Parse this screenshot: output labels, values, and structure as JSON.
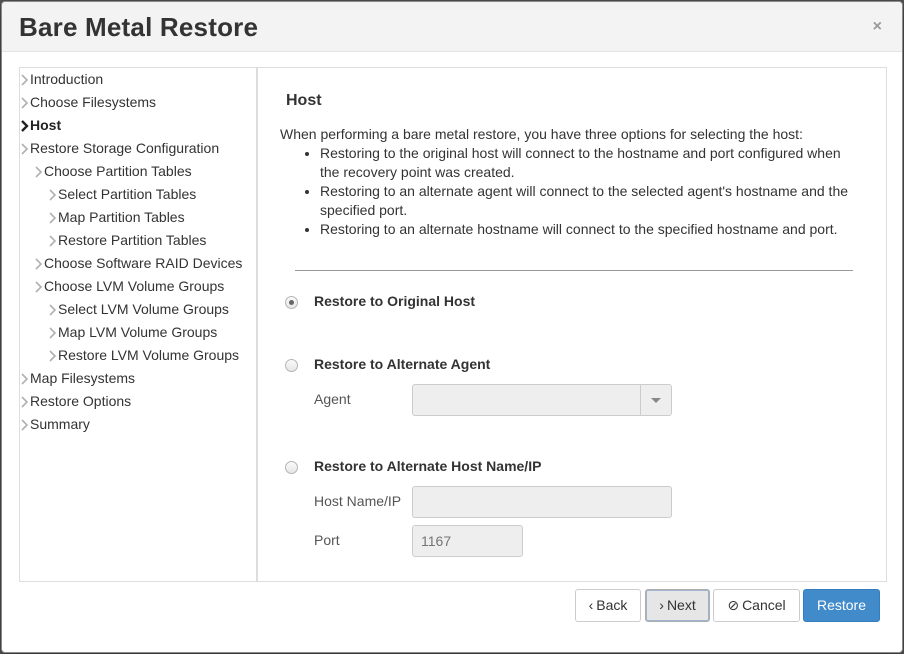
{
  "dialog": {
    "title": "Bare Metal Restore",
    "close_icon": "×"
  },
  "nav": {
    "items": [
      {
        "label": "Introduction",
        "level": 0,
        "active": false
      },
      {
        "label": "Choose Filesystems",
        "level": 0,
        "active": false
      },
      {
        "label": "Host",
        "level": 0,
        "active": true
      },
      {
        "label": "Restore Storage Configuration",
        "level": 0,
        "active": false
      },
      {
        "label": "Choose Partition Tables",
        "level": 1,
        "active": false
      },
      {
        "label": "Select Partition Tables",
        "level": 2,
        "active": false
      },
      {
        "label": "Map Partition Tables",
        "level": 2,
        "active": false
      },
      {
        "label": "Restore Partition Tables",
        "level": 2,
        "active": false
      },
      {
        "label": "Choose Software RAID Devices",
        "level": 1,
        "active": false
      },
      {
        "label": "Choose LVM Volume Groups",
        "level": 1,
        "active": false
      },
      {
        "label": "Select LVM Volume Groups",
        "level": 2,
        "active": false
      },
      {
        "label": "Map LVM Volume Groups",
        "level": 2,
        "active": false
      },
      {
        "label": "Restore LVM Volume Groups",
        "level": 2,
        "active": false
      },
      {
        "label": "Map Filesystems",
        "level": 0,
        "active": false
      },
      {
        "label": "Restore Options",
        "level": 0,
        "active": false
      },
      {
        "label": "Summary",
        "level": 0,
        "active": false
      }
    ]
  },
  "main": {
    "section_title": "Host",
    "intro": "When performing a bare metal restore, you have three options for selecting the host:",
    "bullets": [
      "Restoring to the original host will connect to the hostname and port configured when the recovery point was created.",
      "Restoring to an alternate agent will connect to the selected agent's hostname and the specified port.",
      "Restoring to an alternate hostname will connect to the specified hostname and port."
    ],
    "options": {
      "original": {
        "label": "Restore to Original Host",
        "checked": true
      },
      "agent": {
        "label": "Restore to Alternate Agent",
        "checked": false,
        "field_label": "Agent",
        "value": ""
      },
      "hostname": {
        "label": "Restore to Alternate Host Name/IP",
        "checked": false,
        "host_label": "Host Name/IP",
        "host_value": "",
        "port_label": "Port",
        "port_placeholder": "1167"
      }
    }
  },
  "footer": {
    "back": "Back",
    "next": "Next",
    "cancel": "Cancel",
    "restore": "Restore"
  }
}
